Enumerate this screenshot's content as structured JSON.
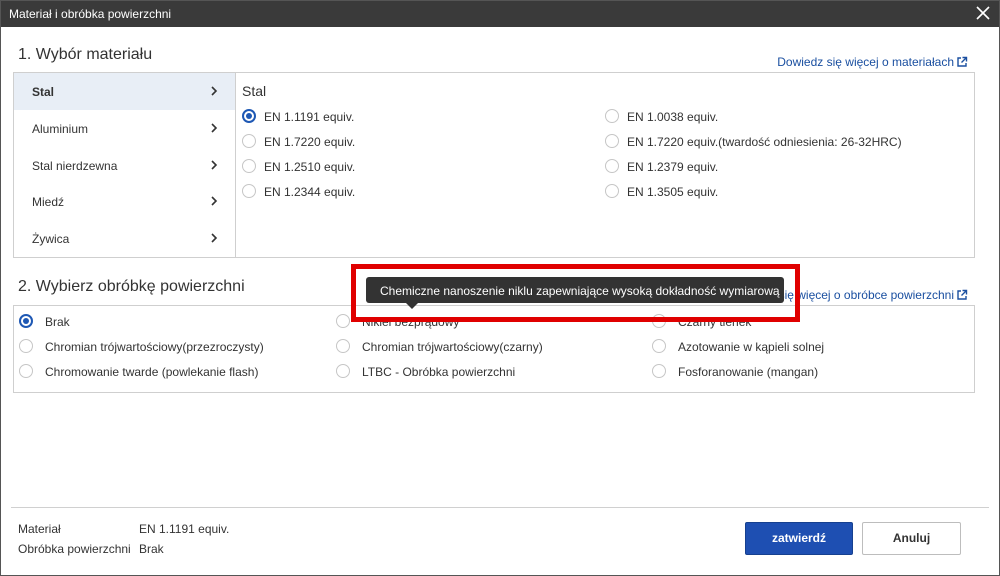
{
  "dialog": {
    "title": "Materiał i obróbka powierzchni"
  },
  "material_section": {
    "title": "1. Wybór materiału",
    "learn_more": "Dowiedz się więcej o materiałach",
    "categories": [
      {
        "label": "Stal",
        "active": true
      },
      {
        "label": "Aluminium",
        "active": false
      },
      {
        "label": "Stal nierdzewna",
        "active": false
      },
      {
        "label": "Miedź",
        "active": false
      },
      {
        "label": "Żywica",
        "active": false
      }
    ],
    "pane_title": "Stal",
    "options": [
      {
        "label": "EN 1.1191 equiv.",
        "checked": true
      },
      {
        "label": "EN 1.0038 equiv.",
        "checked": false
      },
      {
        "label": "EN 1.7220 equiv.",
        "checked": false
      },
      {
        "label": "EN 1.7220 equiv.(twardość odniesienia: 26-32HRC)",
        "checked": false
      },
      {
        "label": "EN 1.2510 equiv.",
        "checked": false
      },
      {
        "label": "EN 1.2379 equiv.",
        "checked": false
      },
      {
        "label": "EN 1.2344 equiv.",
        "checked": false
      },
      {
        "label": "EN 1.3505 equiv.",
        "checked": false
      }
    ]
  },
  "surface_section": {
    "title": "2. Wybierz obróbkę powierzchni",
    "learn_more_partial": "się więcej o obróbce powierzchni",
    "options": [
      {
        "label": "Brak",
        "checked": true
      },
      {
        "label": "Nikiel bezprądowy",
        "checked": false
      },
      {
        "label": "Czarny tlenek",
        "checked": false
      },
      {
        "label": "Chromian trójwartościowy(przezroczysty)",
        "checked": false
      },
      {
        "label": "Chromian trójwartościowy(czarny)",
        "checked": false
      },
      {
        "label": "Azotowanie w kąpieli solnej",
        "checked": false
      },
      {
        "label": "Chromowanie twarde (powlekanie flash)",
        "checked": false
      },
      {
        "label": "LTBC - Obróbka powierzchni",
        "checked": false
      },
      {
        "label": "Fosforanowanie (mangan)",
        "checked": false
      }
    ]
  },
  "tooltip": {
    "text": "Chemiczne nanoszenie niklu zapewniające wysoką dokładność wymiarową"
  },
  "summary": {
    "material_label": "Materiał",
    "material_value": "EN 1.1191 equiv.",
    "surface_label": "Obróbka powierzchni",
    "surface_value": "Brak"
  },
  "buttons": {
    "confirm": "zatwierdź",
    "cancel": "Anuluj"
  },
  "colors": {
    "title_bar": "#3a3a3a",
    "primary": "#1e4fb2",
    "link": "#1a4fa0",
    "highlight": "#e00000"
  }
}
